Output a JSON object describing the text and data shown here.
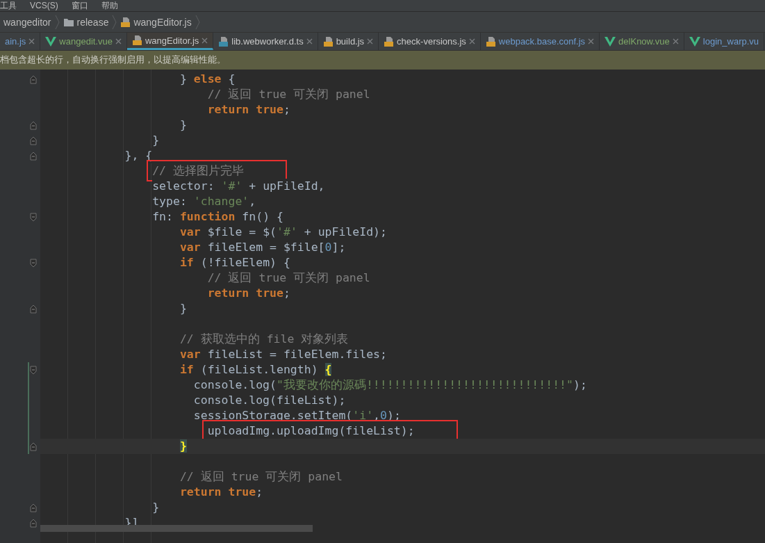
{
  "menu_bar": [
    {
      "label": "工具"
    },
    {
      "label": "VCS(S)"
    },
    {
      "label": "窗口"
    },
    {
      "label": "帮助"
    }
  ],
  "breadcrumbs": [
    {
      "label": "wangeditor",
      "kind": "plain"
    },
    {
      "label": "release",
      "kind": "folder"
    },
    {
      "label": "wangEditor.js",
      "kind": "js"
    }
  ],
  "tabs": [
    {
      "label": "ain.js",
      "kind": "none",
      "color": "#6d9bcf",
      "selected": false
    },
    {
      "label": "wangedit.vue",
      "kind": "vue",
      "color": "#7fa868",
      "selected": false
    },
    {
      "label": "wangEditor.js",
      "kind": "js",
      "color": "#c8c8c8",
      "selected": true
    },
    {
      "label": "lib.webworker.d.ts",
      "kind": "ts",
      "color": "#c8c8c8",
      "selected": false
    },
    {
      "label": "build.js",
      "kind": "js",
      "color": "#c8c8c8",
      "selected": false
    },
    {
      "label": "check-versions.js",
      "kind": "js",
      "color": "#c8c8c8",
      "selected": false
    },
    {
      "label": "webpack.base.conf.js",
      "kind": "js",
      "color": "#6d9bcf",
      "selected": false
    },
    {
      "label": "delKnow.vue",
      "kind": "vue",
      "color": "#7fa868",
      "selected": false
    },
    {
      "label": "login_warp.vu",
      "kind": "vue",
      "color": "#6d9bcf",
      "selected": false
    }
  ],
  "notice": "档包含超长的行，自动换行强制启用，以提高编辑性能。",
  "code_lines": [
    {
      "kind": "code",
      "fold_end": true,
      "tokens": [
        {
          "kind": "plain",
          "text": "                } "
        },
        {
          "kind": "keyword",
          "text": "else"
        },
        {
          "kind": "plain",
          "text": " {"
        }
      ]
    },
    {
      "kind": "code",
      "tokens": [
        {
          "kind": "comment",
          "text": "                    // 返回 true 可关闭 panel"
        }
      ]
    },
    {
      "kind": "code",
      "tokens": [
        {
          "kind": "keyword",
          "text": "                    return true"
        },
        {
          "kind": "plain",
          "text": ";"
        }
      ]
    },
    {
      "kind": "code",
      "fold_end": true,
      "tokens": [
        {
          "kind": "plain",
          "text": "                }"
        }
      ]
    },
    {
      "kind": "code",
      "fold_end": true,
      "tokens": [
        {
          "kind": "plain",
          "text": "            }"
        }
      ]
    },
    {
      "kind": "code",
      "fold_end": true,
      "tokens": [
        {
          "kind": "plain",
          "text": "        }, {"
        }
      ]
    },
    {
      "kind": "code",
      "boxed": true,
      "tokens": [
        {
          "kind": "comment",
          "text": "            // 选择图片完毕"
        }
      ]
    },
    {
      "kind": "code",
      "tokens": [
        {
          "kind": "plain",
          "text": "            selector: "
        },
        {
          "kind": "string",
          "text": "'#'"
        },
        {
          "kind": "plain",
          "text": " + upFileId,"
        }
      ]
    },
    {
      "kind": "code",
      "tokens": [
        {
          "kind": "plain",
          "text": "            type: "
        },
        {
          "kind": "string",
          "text": "'change'"
        },
        {
          "kind": "plain",
          "text": ","
        }
      ]
    },
    {
      "kind": "code",
      "fold_start": true,
      "tokens": [
        {
          "kind": "plain",
          "text": "            fn: "
        },
        {
          "kind": "keyword",
          "text": "function"
        },
        {
          "kind": "plain",
          "text": " fn() {"
        }
      ]
    },
    {
      "kind": "code",
      "tokens": [
        {
          "kind": "keyword",
          "text": "                var"
        },
        {
          "kind": "plain",
          "text": " $file = $("
        },
        {
          "kind": "string",
          "text": "'#'"
        },
        {
          "kind": "plain",
          "text": " + upFileId);"
        }
      ]
    },
    {
      "kind": "code",
      "tokens": [
        {
          "kind": "keyword",
          "text": "                var"
        },
        {
          "kind": "plain",
          "text": " fileElem = $file["
        },
        {
          "kind": "number",
          "text": "0"
        },
        {
          "kind": "plain",
          "text": "];"
        }
      ]
    },
    {
      "kind": "code",
      "fold_start": true,
      "tokens": [
        {
          "kind": "keyword",
          "text": "                if"
        },
        {
          "kind": "plain",
          "text": " (!fileElem) {"
        }
      ]
    },
    {
      "kind": "code",
      "tokens": [
        {
          "kind": "comment",
          "text": "                    // 返回 true 可关闭 panel"
        }
      ]
    },
    {
      "kind": "code",
      "tokens": [
        {
          "kind": "keyword",
          "text": "                    return true"
        },
        {
          "kind": "plain",
          "text": ";"
        }
      ]
    },
    {
      "kind": "code",
      "fold_end": true,
      "tokens": [
        {
          "kind": "plain",
          "text": "                }"
        }
      ]
    },
    {
      "kind": "blank"
    },
    {
      "kind": "code",
      "tokens": [
        {
          "kind": "comment",
          "text": "                // 获取选中的 file 对象列表"
        }
      ]
    },
    {
      "kind": "code",
      "tokens": [
        {
          "kind": "keyword",
          "text": "                var"
        },
        {
          "kind": "plain",
          "text": " fileList = fileElem.files;"
        }
      ]
    },
    {
      "kind": "code",
      "fold_start": true,
      "changed": true,
      "tokens": [
        {
          "kind": "keyword",
          "text": "                if"
        },
        {
          "kind": "plain",
          "text": " (fileList.length) "
        },
        {
          "kind": "brace",
          "text": "{"
        }
      ]
    },
    {
      "kind": "code",
      "changed": true,
      "tokens": [
        {
          "kind": "plain",
          "text": "                  console.log("
        },
        {
          "kind": "string",
          "text": "\"我要改你的源碼!!!!!!!!!!!!!!!!!!!!!!!!!!!!!\""
        },
        {
          "kind": "plain",
          "text": ");"
        }
      ]
    },
    {
      "kind": "code",
      "changed": true,
      "tokens": [
        {
          "kind": "plain",
          "text": "                  console.log(fileList);"
        }
      ]
    },
    {
      "kind": "code",
      "changed": true,
      "tokens": [
        {
          "kind": "plain",
          "text": "                  sessionStorage.setItem("
        },
        {
          "kind": "string",
          "text": "'i'"
        },
        {
          "kind": "plain",
          "text": ","
        },
        {
          "kind": "number",
          "text": "0"
        },
        {
          "kind": "plain",
          "text": ");"
        }
      ]
    },
    {
      "kind": "code",
      "changed": true,
      "boxed": true,
      "tokens": [
        {
          "kind": "plain",
          "text": "                    uploadImg.uploadImg(fileList);"
        }
      ]
    },
    {
      "kind": "code",
      "fold_end": true,
      "changed": true,
      "current": true,
      "tokens": [
        {
          "kind": "brace",
          "text": "                }"
        }
      ]
    },
    {
      "kind": "blank"
    },
    {
      "kind": "code",
      "tokens": [
        {
          "kind": "comment",
          "text": "                // 返回 true 可关闭 panel"
        }
      ]
    },
    {
      "kind": "code",
      "tokens": [
        {
          "kind": "keyword",
          "text": "                return true"
        },
        {
          "kind": "plain",
          "text": ";"
        }
      ]
    },
    {
      "kind": "code",
      "fold_end": true,
      "tokens": [
        {
          "kind": "plain",
          "text": "            }"
        }
      ]
    },
    {
      "kind": "code",
      "fold_end": true,
      "tokens": [
        {
          "kind": "plain",
          "text": "        }]"
        }
      ]
    }
  ]
}
